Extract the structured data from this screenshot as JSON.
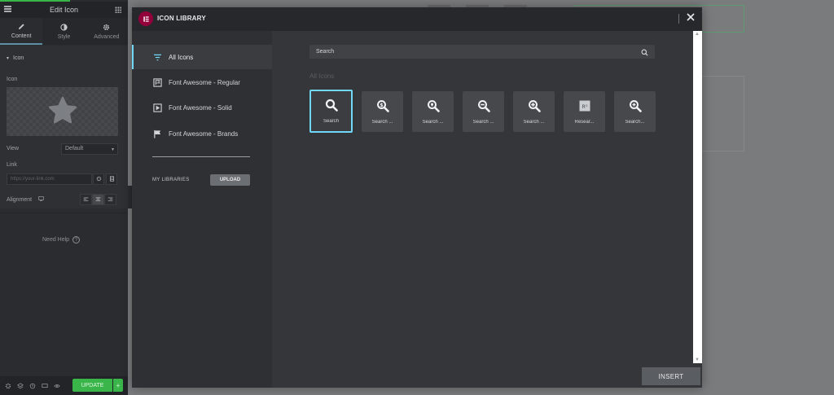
{
  "editor_panel": {
    "title": "Edit Icon",
    "tabs": [
      {
        "label": "Content",
        "icon": "pencil-icon"
      },
      {
        "label": "Style",
        "icon": "half-circle-icon"
      },
      {
        "label": "Advanced",
        "icon": "gear-icon"
      }
    ],
    "section_title": "Icon",
    "icon_label": "Icon",
    "preview_icon": "star-icon",
    "view_label": "View",
    "view_value": "Default",
    "link_label": "Link",
    "link_placeholder": "https://your-link.com",
    "alignment_label": "Alignment",
    "need_help": "Need Help",
    "update_label": "UPDATE",
    "update_more": "+"
  },
  "modal": {
    "title": "ICON LIBRARY",
    "close_symbol": "✕",
    "sidebar": {
      "tabs": [
        {
          "label": "All Icons",
          "icon": "filter-lines-icon",
          "active": true
        },
        {
          "label": "Font Awesome - Regular",
          "icon": "flag-outline-icon"
        },
        {
          "label": "Font Awesome - Solid",
          "icon": "play-square-icon"
        },
        {
          "label": "Font Awesome - Brands",
          "icon": "flag-icon"
        }
      ],
      "my_libraries": "MY LIBRARIES",
      "upload_label": "UPLOAD"
    },
    "search": {
      "value": "Search"
    },
    "section_heading": "All Icons",
    "icons": [
      {
        "label": "Search",
        "icon": "search-icon",
        "selected": true
      },
      {
        "label": "Search ...",
        "icon": "search-dollar-icon"
      },
      {
        "label": "Search ...",
        "icon": "search-location-icon"
      },
      {
        "label": "Search ...",
        "icon": "search-minus-icon"
      },
      {
        "label": "Search ...",
        "icon": "search-plus-icon"
      },
      {
        "label": "Resear...",
        "icon": "researchgate-icon"
      },
      {
        "label": "Search...",
        "icon": "search-plus-alt-icon"
      }
    ],
    "insert_label": "INSERT"
  },
  "colors": {
    "accent": "#71d7f7",
    "update_green": "#39b54a",
    "logo": "#92003b"
  }
}
